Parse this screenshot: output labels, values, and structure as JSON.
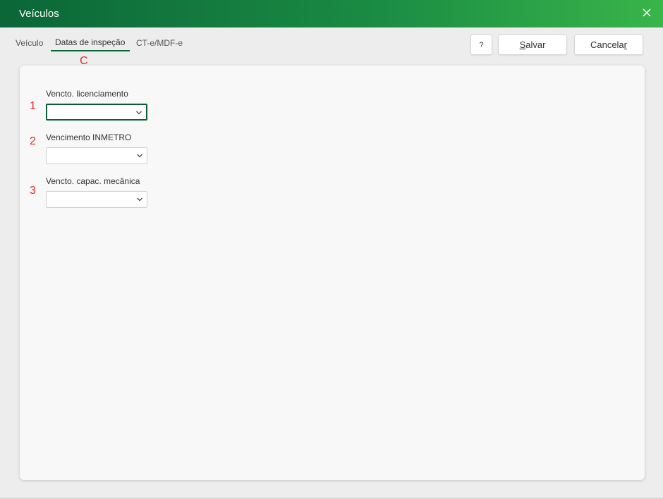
{
  "window": {
    "title": "Veículos",
    "close_icon": "close-icon"
  },
  "tabs": [
    {
      "label": "Veículo",
      "active": false
    },
    {
      "label": "Datas de inspeção",
      "active": true
    },
    {
      "label": "CT-e/MDF-e",
      "active": false
    }
  ],
  "buttons": {
    "help": "?",
    "save_prefix": "",
    "save_mnemonic": "S",
    "save_rest": "alvar",
    "cancel_prefix": "Cancela",
    "cancel_mnemonic": "r"
  },
  "annotations": {
    "c": "C",
    "one": "1",
    "two": "2",
    "three": "3"
  },
  "fields": [
    {
      "label": "Vencto. licenciamento",
      "value": ""
    },
    {
      "label": "Vencimento INMETRO",
      "value": ""
    },
    {
      "label": "Vencto. capac. mecânica",
      "value": ""
    }
  ],
  "colors": {
    "accent": "#0b6638",
    "accent_light": "#39b54a",
    "annotation": "#d92b2b"
  }
}
